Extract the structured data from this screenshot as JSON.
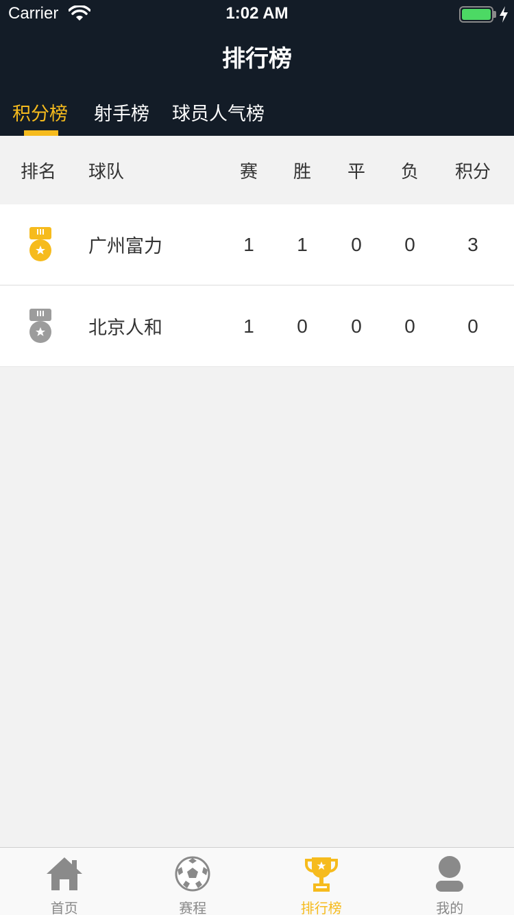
{
  "status_bar": {
    "carrier": "Carrier",
    "time": "1:02 AM",
    "battery_level": 1.0
  },
  "nav": {
    "title": "排行榜"
  },
  "tabs": [
    {
      "label": "积分榜",
      "active": true
    },
    {
      "label": "射手榜",
      "active": false
    },
    {
      "label": "球员人气榜",
      "active": false
    }
  ],
  "table": {
    "headers": {
      "rank": "排名",
      "team": "球队",
      "played": "赛",
      "won": "胜",
      "drawn": "平",
      "lost": "负",
      "points": "积分"
    },
    "rows": [
      {
        "rank_icon": "gold-medal-icon",
        "team": "广州富力",
        "played": "1",
        "won": "1",
        "drawn": "0",
        "lost": "0",
        "points": "3"
      },
      {
        "rank_icon": "silver-medal-icon",
        "team": "北京人和",
        "played": "1",
        "won": "0",
        "drawn": "0",
        "lost": "0",
        "points": "0"
      }
    ]
  },
  "tabbar": [
    {
      "label": "首页",
      "icon": "home-icon",
      "active": false
    },
    {
      "label": "赛程",
      "icon": "soccer-ball-icon",
      "active": false
    },
    {
      "label": "排行榜",
      "icon": "trophy-icon",
      "active": true
    },
    {
      "label": "我的",
      "icon": "profile-icon",
      "active": false
    }
  ],
  "colors": {
    "header_bg": "#131c27",
    "accent": "#f6bb1d",
    "gold": "#f6bb1d",
    "silver": "#9c9c9c",
    "inactive": "#8a8a8a"
  }
}
